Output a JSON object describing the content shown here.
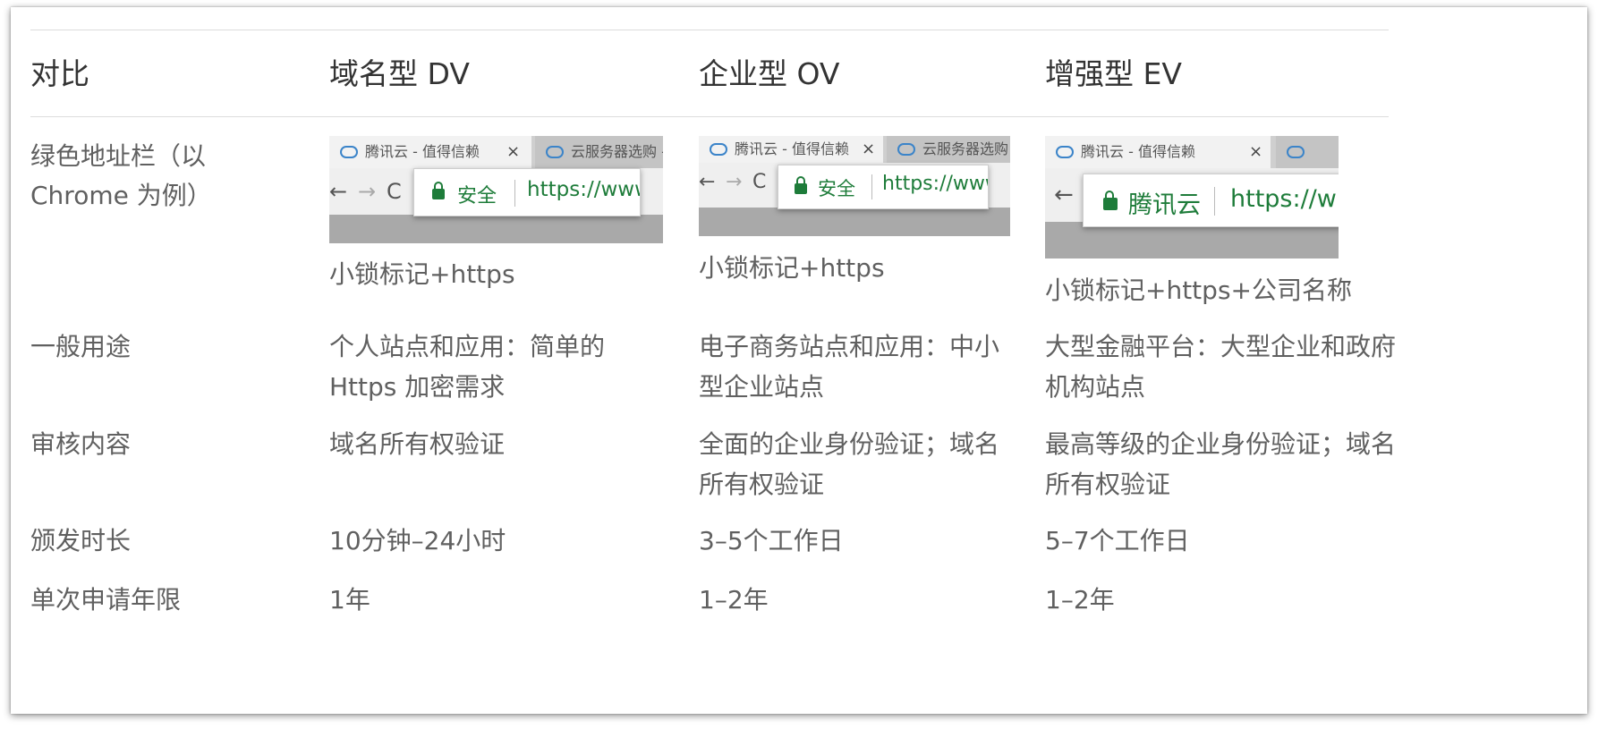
{
  "headers": {
    "compare": "对比",
    "dv": "域名型 DV",
    "ov": "企业型 OV",
    "ev": "增强型 EV"
  },
  "rows": {
    "address_bar": {
      "label_line1": "绿色地址栏（以",
      "label_line2": "Chrome 为例）",
      "dv_caption": "小锁标记+https",
      "ov_caption": "小锁标记+https",
      "ev_caption": "小锁标记+https+公司名称"
    },
    "usage": {
      "label": "一般用途",
      "dv_line1": "个人站点和应用：简单的",
      "dv_line2": "Https 加密需求",
      "ov_line1": "电子商务站点和应用：中小",
      "ov_line2": "型企业站点",
      "ev_line1": "大型金融平台：大型企业和政府",
      "ev_line2": "机构站点"
    },
    "audit": {
      "label": "审核内容",
      "dv_line1": "域名所有权验证",
      "ov_line1": "全面的企业身份验证；域名",
      "ov_line2": "所有权验证",
      "ev_line1": "最高等级的企业身份验证；域名",
      "ev_line2": "所有权验证"
    },
    "issue_time": {
      "label": "颁发时长",
      "dv": "10分钟–24小时",
      "ov": "3–5个工作日",
      "ev": "5–7个工作日"
    },
    "validity": {
      "label": "单次申请年限",
      "dv": "1年",
      "ov": "1–2年",
      "ev": "1–2年"
    }
  },
  "screenshots": {
    "tab1_title": "腾讯云 - 值得信赖",
    "tab2_title": "云服务器选购 - 腾",
    "tab_close": "×",
    "nav_back": "←",
    "nav_forward": "→",
    "nav_reload": "C",
    "dv_secure": "安全",
    "ov_secure": "安全",
    "ev_company": "腾讯云",
    "dv_url": "https://www",
    "ov_url": "https://www",
    "ev_url": "https://w",
    "secure_color": "#1e7c3a"
  }
}
